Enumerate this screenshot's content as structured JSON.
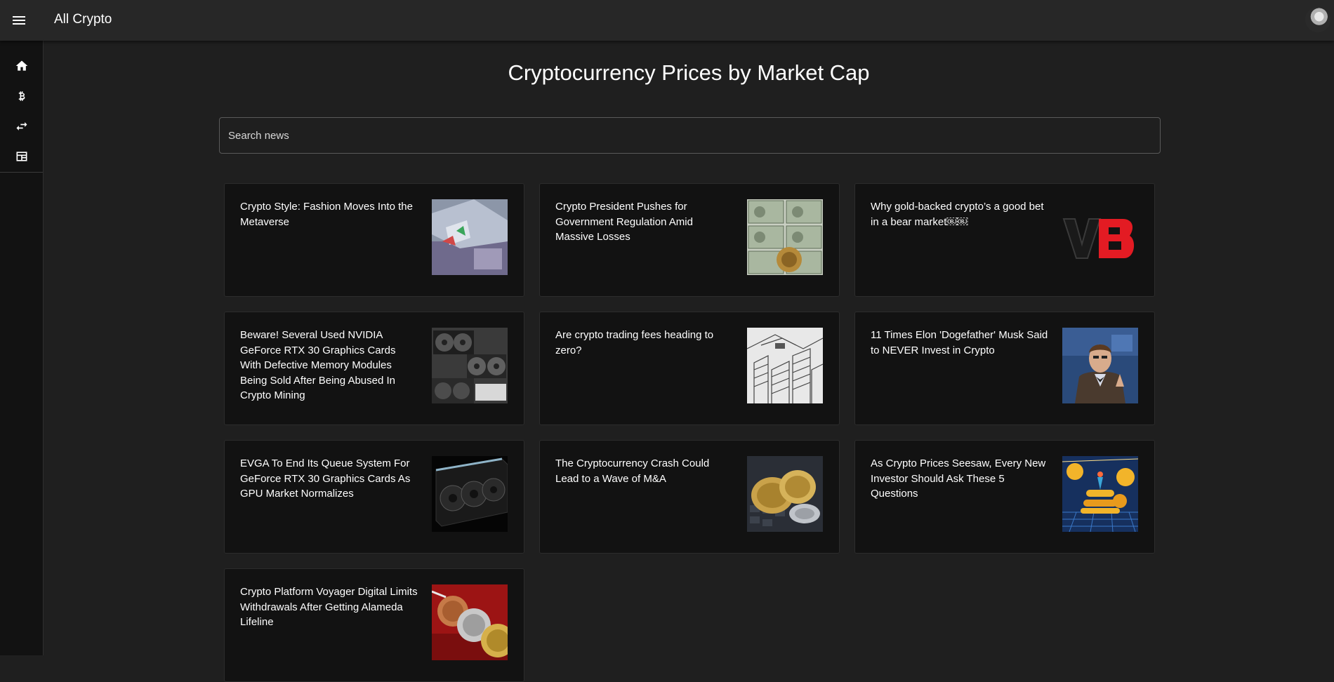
{
  "header": {
    "app_title": "All Crypto",
    "menu_icon": "menu-icon",
    "avatar_icon": "user-avatar"
  },
  "sidebar": {
    "items": [
      {
        "name": "home",
        "icon": "home-icon"
      },
      {
        "name": "cryptocurrencies",
        "icon": "bitcoin-icon"
      },
      {
        "name": "exchanges",
        "icon": "swap-icon"
      },
      {
        "name": "news",
        "icon": "news-icon"
      }
    ]
  },
  "main": {
    "title": "Cryptocurrency Prices by Market Cap",
    "search": {
      "placeholder": "Search news",
      "value": ""
    }
  },
  "news": [
    {
      "title": "Crypto Style: Fashion Moves Into the Metaverse",
      "image": "metaverse-fashion-thumbnail"
    },
    {
      "title": "Crypto President Pushes for Government Regulation Amid Massive Losses",
      "image": "dollar-bills-bitcoin-thumbnail"
    },
    {
      "title": "Why gold-backed crypto’s a good bet in a bear market￼￼",
      "image": "vb-logo-thumbnail"
    },
    {
      "title": "Beware! Several Used NVIDIA GeForce RTX 30 Graphics Cards With Defective Memory Modules Being Sold After Being Abused In Crypto Mining",
      "image": "graphics-cards-thumbnail"
    },
    {
      "title": "Are crypto trading fees heading to zero?",
      "image": "city-sketch-thumbnail"
    },
    {
      "title": "11 Times Elon 'Dogefather' Musk Said to NEVER Invest in Crypto",
      "image": "tv-host-thumbnail"
    },
    {
      "title": "EVGA To End Its Queue System For GeForce RTX 30 Graphics Cards As GPU Market Normalizes",
      "image": "evga-gpu-thumbnail"
    },
    {
      "title": "The Cryptocurrency Crash Could Lead to a Wave of M&A",
      "image": "gold-coins-keyboard-thumbnail"
    },
    {
      "title": "As Crypto Prices Seesaw, Every New Investor Should Ask These 5 Questions",
      "image": "coins-illustration-thumbnail"
    },
    {
      "title": "Crypto Platform Voyager Digital Limits Withdrawals After Getting Alameda Lifeline",
      "image": "coins-red-background-thumbnail"
    }
  ]
}
